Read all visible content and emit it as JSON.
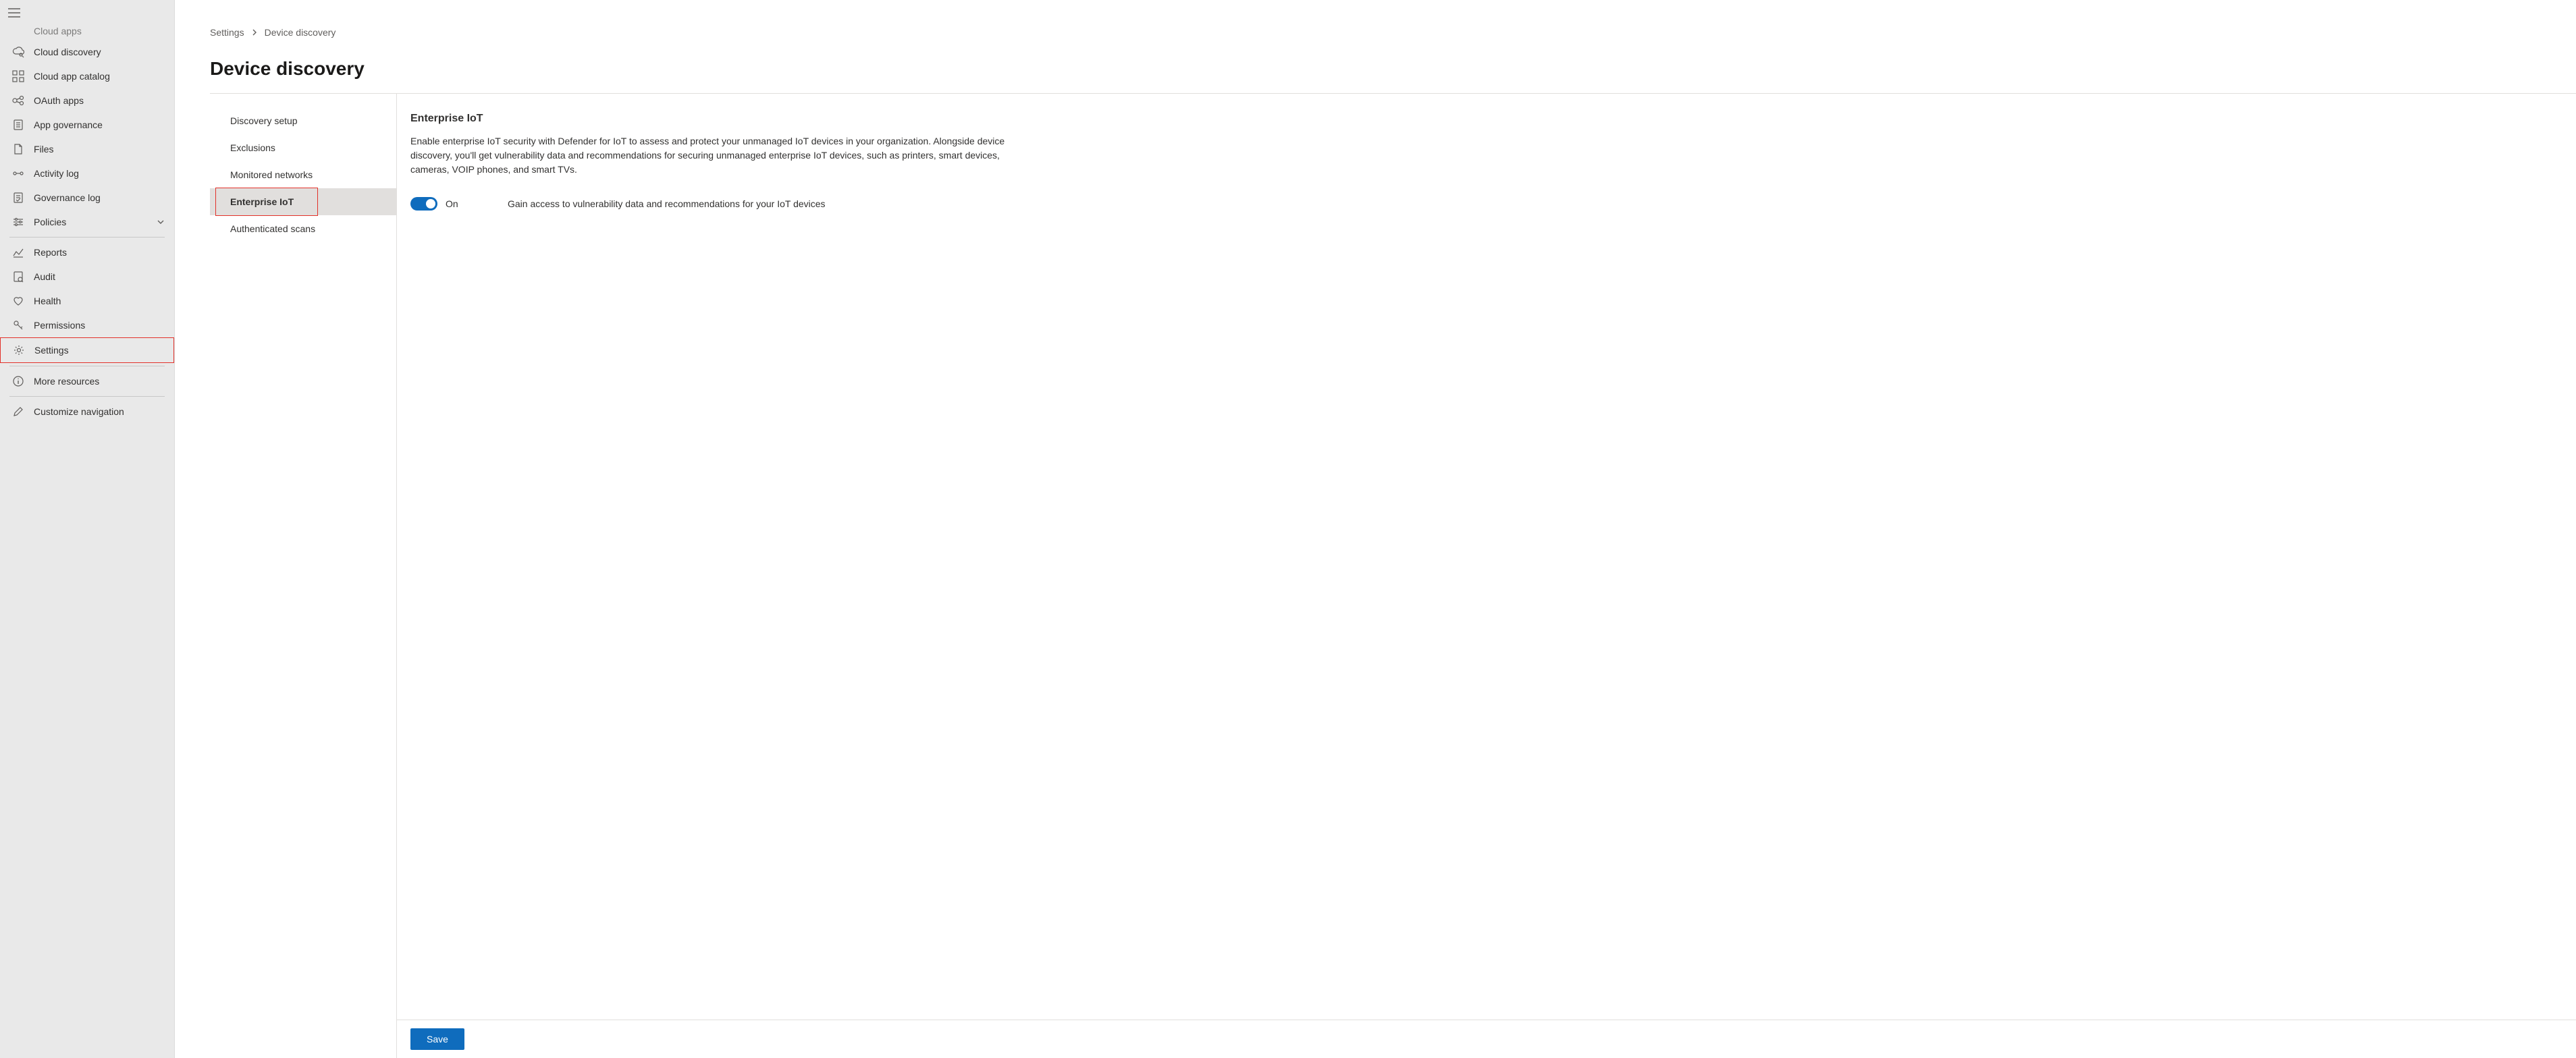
{
  "sidebar": {
    "partialTop": "Cloud apps",
    "items": [
      {
        "label": "Cloud discovery",
        "icon": "cloud-discovery"
      },
      {
        "label": "Cloud app catalog",
        "icon": "catalog"
      },
      {
        "label": "OAuth apps",
        "icon": "oauth"
      },
      {
        "label": "App governance",
        "icon": "app-governance"
      },
      {
        "label": "Files",
        "icon": "files"
      },
      {
        "label": "Activity log",
        "icon": "activity"
      },
      {
        "label": "Governance log",
        "icon": "governance-log"
      },
      {
        "label": "Policies",
        "icon": "policies",
        "expandable": true
      }
    ],
    "items2": [
      {
        "label": "Reports",
        "icon": "reports"
      },
      {
        "label": "Audit",
        "icon": "audit"
      },
      {
        "label": "Health",
        "icon": "health"
      },
      {
        "label": "Permissions",
        "icon": "permissions"
      },
      {
        "label": "Settings",
        "icon": "settings",
        "highlight": true
      }
    ],
    "items3": [
      {
        "label": "More resources",
        "icon": "info"
      }
    ],
    "items4": [
      {
        "label": "Customize navigation",
        "icon": "edit"
      }
    ]
  },
  "breadcrumb": {
    "root": "Settings",
    "current": "Device discovery"
  },
  "page": {
    "title": "Device discovery"
  },
  "subnav": {
    "items": [
      {
        "label": "Discovery setup"
      },
      {
        "label": "Exclusions"
      },
      {
        "label": "Monitored networks"
      },
      {
        "label": "Enterprise IoT",
        "active": true,
        "highlight": true
      },
      {
        "label": "Authenticated scans"
      }
    ]
  },
  "detail": {
    "heading": "Enterprise IoT",
    "description": "Enable enterprise IoT security with Defender for IoT to assess and protect your unmanaged IoT devices in your organization. Alongside device discovery, you'll get vulnerability data and recommendations for securing unmanaged enterprise IoT devices, such as printers, smart devices, cameras, VOIP phones, and smart TVs.",
    "toggleState": "On",
    "toggleHint": "Gain access to vulnerability data and recommendations for your IoT devices",
    "saveLabel": "Save"
  }
}
